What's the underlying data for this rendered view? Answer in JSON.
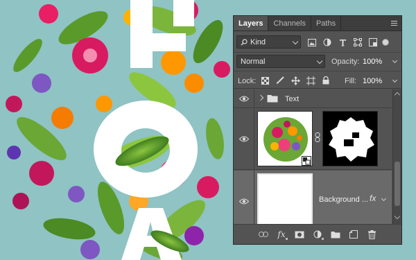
{
  "canvas": {
    "background_color": "#8fc3c4",
    "letters": [
      "F",
      "O",
      "A"
    ]
  },
  "panel": {
    "tabs": [
      {
        "label": "Layers",
        "active": true
      },
      {
        "label": "Channels",
        "active": false
      },
      {
        "label": "Paths",
        "active": false
      }
    ],
    "menu_icon": "panel-menu-icon",
    "filter": {
      "kind_label": "Kind",
      "icons": [
        "image-filter-icon",
        "adjustment-filter-icon",
        "type-filter-icon",
        "shape-filter-icon",
        "smart-object-filter-icon"
      ]
    },
    "blend": {
      "mode": "Normal",
      "opacity_label": "Opacity:",
      "opacity_value": "100%"
    },
    "lock": {
      "label": "Lock:",
      "icons": [
        "lock-transparent-pixels-icon",
        "lock-image-pixels-icon",
        "lock-position-icon",
        "lock-artboard-icon",
        "lock-all-icon"
      ],
      "fill_label": "Fill:",
      "fill_value": "100%"
    },
    "layers": [
      {
        "name": "Text",
        "type": "group",
        "visible": true
      },
      {
        "name": "",
        "type": "smart-object-with-mask",
        "visible": true
      },
      {
        "name": "Background ...",
        "type": "pixel",
        "visible": true,
        "fx": "fx"
      }
    ],
    "footer_icons": [
      "link-layers-icon",
      "add-style-icon",
      "add-mask-icon",
      "new-fill-adjustment-icon",
      "new-group-icon",
      "new-layer-icon",
      "delete-layer-icon"
    ]
  }
}
